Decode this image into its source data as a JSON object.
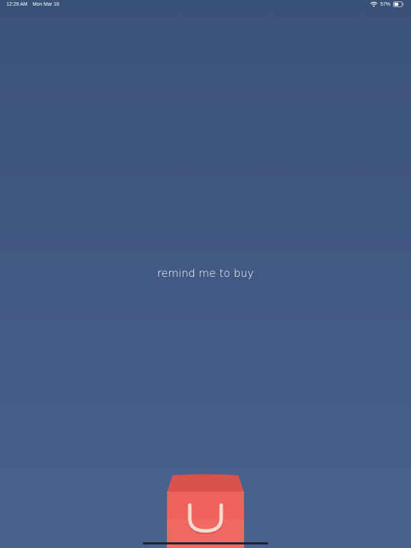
{
  "status_bar": {
    "time": "12:29 AM",
    "date": "Mon Mar 18",
    "battery_percent": "57%",
    "battery_level": 0.57,
    "wifi_icon": "wifi-icon",
    "battery_icon": "battery-icon"
  },
  "main": {
    "prompt": "remind me to buy"
  },
  "bag": {
    "icon": "shopping-bag-icon",
    "colors": {
      "body": "#f0635d",
      "top": "#d9524c",
      "handle": "#f7d9cf"
    }
  }
}
